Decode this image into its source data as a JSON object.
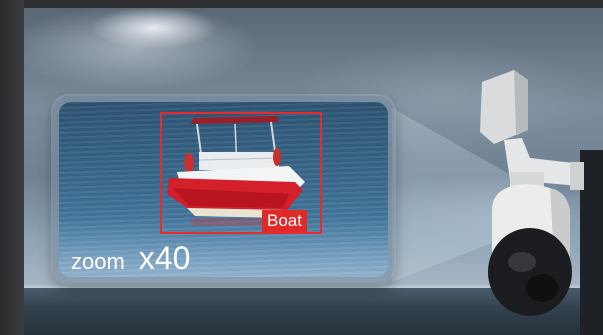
{
  "zoom_overlay": {
    "caption_word": "zoom",
    "zoom_level": "x40"
  },
  "detection": {
    "label": "Boat",
    "box_color": "#e52b2b"
  },
  "icons": {
    "camera": "ptz-camera-icon",
    "boat": "boat-icon"
  }
}
